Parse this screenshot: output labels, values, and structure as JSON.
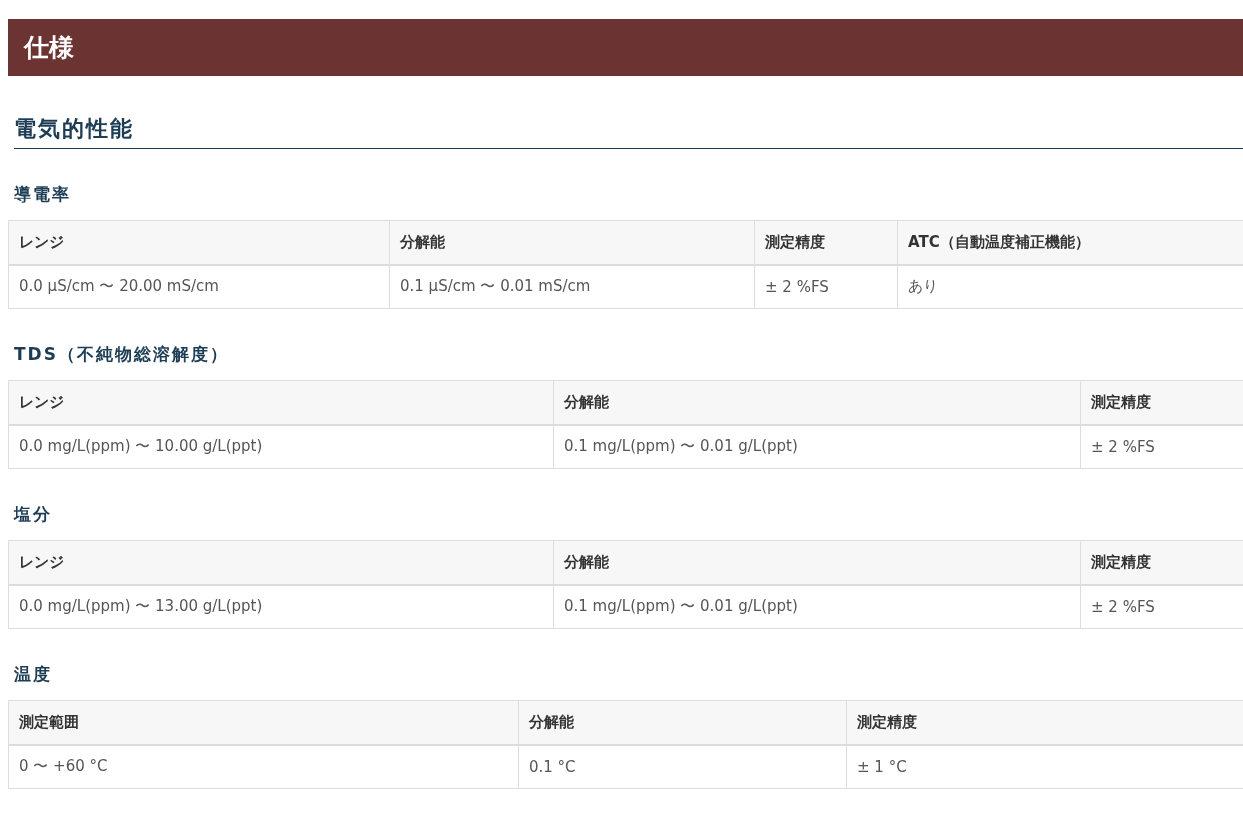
{
  "page_title": "仕様",
  "section_heading": "電気的性能",
  "groups": [
    {
      "heading": "導電率",
      "columns": [
        "レンジ",
        "分解能",
        "測定精度",
        "ATC（自動温度補正機能）"
      ],
      "rows": [
        [
          "0.0 μS/cm 〜 20.00 mS/cm",
          "0.1 μS/cm 〜 0.01 mS/cm",
          "± 2 %FS",
          "あり"
        ]
      ]
    },
    {
      "heading": "TDS（不純物総溶解度）",
      "columns": [
        "レンジ",
        "分解能",
        "測定精度"
      ],
      "rows": [
        [
          "0.0 mg/L(ppm) 〜 10.00 g/L(ppt)",
          "0.1 mg/L(ppm) 〜 0.01 g/L(ppt)",
          "± 2 %FS"
        ]
      ]
    },
    {
      "heading": "塩分",
      "columns": [
        "レンジ",
        "分解能",
        "測定精度"
      ],
      "rows": [
        [
          "0.0 mg/L(ppm) 〜 13.00 g/L(ppt)",
          "0.1 mg/L(ppm) 〜 0.01 g/L(ppt)",
          "± 2 %FS"
        ]
      ]
    },
    {
      "heading": "温度",
      "columns": [
        "測定範囲",
        "分解能",
        "測定精度"
      ],
      "rows": [
        [
          "0 〜 +60 °C",
          "0.1 °C",
          "± 1 °C"
        ]
      ]
    }
  ]
}
